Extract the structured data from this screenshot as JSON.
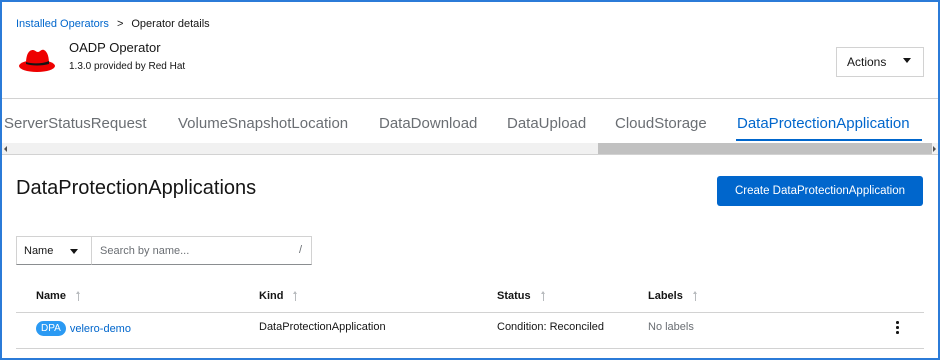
{
  "breadcrumb": {
    "parent_label": "Installed Operators",
    "separator": ">",
    "current_label": "Operator details"
  },
  "operator": {
    "name": "OADP Operator",
    "version_text": "1.3.0 provided by Red Hat",
    "logo_icon": "redhat-hat-icon",
    "logo_color": "#ee0000"
  },
  "actions": {
    "label": "Actions"
  },
  "tabs": [
    {
      "label": "ServerStatusRequest"
    },
    {
      "label": "VolumeSnapshotLocation"
    },
    {
      "label": "DataDownload"
    },
    {
      "label": "DataUpload"
    },
    {
      "label": "CloudStorage"
    },
    {
      "label": "DataProtectionApplication",
      "active": true
    }
  ],
  "page": {
    "title": "DataProtectionApplications",
    "create_button": "Create DataProtectionApplication"
  },
  "filter": {
    "select_value": "Name",
    "search_placeholder": "Search by name...",
    "shortcut_hint": "/"
  },
  "table": {
    "columns": [
      "Name",
      "Kind",
      "Status",
      "Labels"
    ],
    "rows": [
      {
        "badge": "DPA",
        "name": "velero-demo",
        "kind": "DataProtectionApplication",
        "status_label": "Condition:",
        "status_value": "Reconciled",
        "labels": "No labels"
      }
    ]
  },
  "colors": {
    "accent": "#0066cc",
    "frame": "#2b7bd8",
    "badge": "#2b9af3",
    "muted": "#6a6e73"
  }
}
